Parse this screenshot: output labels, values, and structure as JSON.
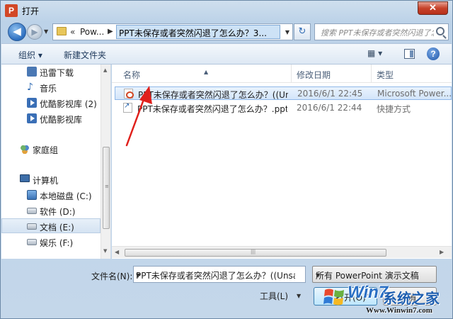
{
  "window": {
    "title": "打开",
    "app_icon": "P",
    "close_glyph": "✕"
  },
  "address": {
    "back_glyph": "◀",
    "forward_glyph": "▶",
    "separator": "«",
    "segment": "Pow...",
    "current": "PPT未保存或者突然闪退了怎么办？3...",
    "refresh_glyph": "↻"
  },
  "search": {
    "placeholder": "搜索 PPT未保存或者突然闪退了怎么..."
  },
  "toolbar": {
    "organize": "组织 ▾",
    "new_folder": "新建文件夹",
    "view_glyph": "▦ ▾",
    "help": "?"
  },
  "nav": {
    "items": [
      {
        "label": "迅雷下载",
        "icon": "download-folder-icon"
      },
      {
        "label": "音乐",
        "icon": "music-icon"
      },
      {
        "label": "优酷影视库 (2)",
        "icon": "video-library-icon"
      },
      {
        "label": "优酷影视库",
        "icon": "video-library-icon"
      },
      {
        "label": "家庭组",
        "icon": "homegroup-icon"
      },
      {
        "label": "计算机",
        "icon": "computer-icon"
      },
      {
        "label": "本地磁盘 (C:)",
        "icon": "drive-icon"
      },
      {
        "label": "软件 (D:)",
        "icon": "drive-icon"
      },
      {
        "label": "文档 (E:)",
        "icon": "drive-icon"
      },
      {
        "label": "娱乐 (F:)",
        "icon": "drive-icon"
      }
    ]
  },
  "files": {
    "columns": {
      "name": "名称",
      "date": "修改日期",
      "type": "类型"
    },
    "rows": [
      {
        "name": "PPT未保存或者突然闪退了怎么办？((Un...",
        "date": "2016/6/1 22:45",
        "type": "Microsoft Power..."
      },
      {
        "name": "PPT未保存或者突然闪退了怎么办？.pptx",
        "date": "2016/6/1 22:44",
        "type": "快捷方式"
      }
    ]
  },
  "bottom": {
    "filename_label": "文件名(N):",
    "filename_value": "PPT未保存或者突然闪退了怎么办？((Unsav",
    "filetype": "所有 PowerPoint 演示文稿",
    "tools": "工具(L)",
    "open": "打开(O)",
    "cancel": "取消"
  },
  "watermark": {
    "line1": "Win7",
    "line2": "系统之家",
    "url": "Www.Winwin7.com"
  },
  "colors": {
    "accent": "#2a6fc4",
    "selection": "#cde2f6",
    "annotation": "#e0201b"
  }
}
